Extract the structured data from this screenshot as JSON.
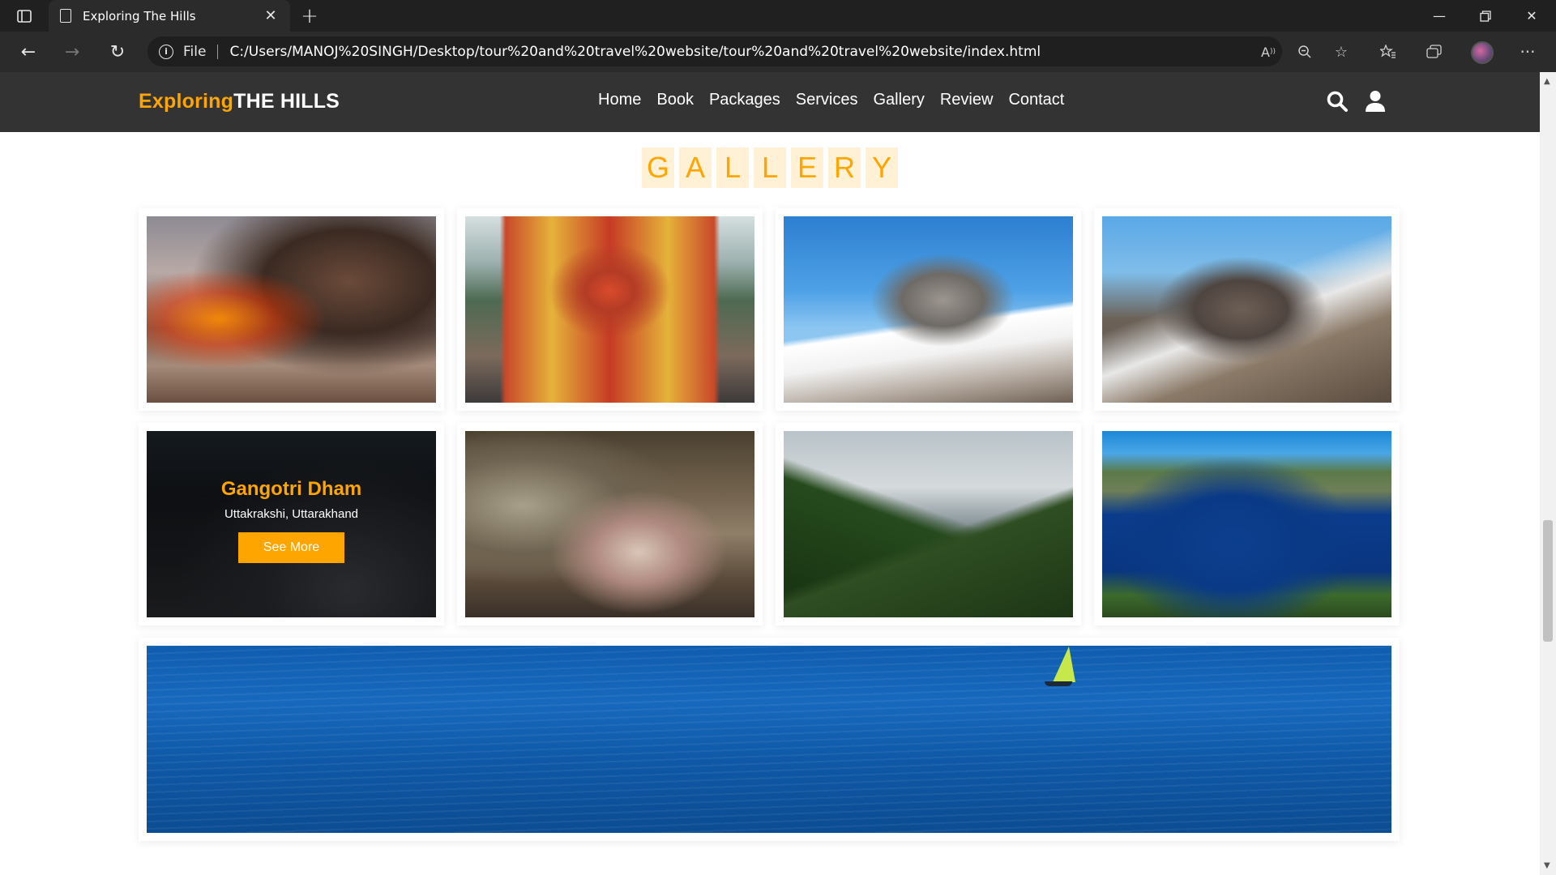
{
  "browser": {
    "tab_title": "Exploring The Hills",
    "address_scheme": "File",
    "url": "C:/Users/MANOJ%20SINGH/Desktop/tour%20and%20travel%20website/tour%20and%20travel%20website/index.html"
  },
  "site": {
    "logo_accent": "Exploring",
    "logo_rest": "THE HILLS",
    "nav": [
      "Home",
      "Book",
      "Packages",
      "Services",
      "Gallery",
      "Review",
      "Contact"
    ],
    "accent_color": "#ffa500",
    "header_color": "#333333"
  },
  "gallery": {
    "heading_letters": [
      "G",
      "A",
      "L",
      "L",
      "E",
      "R",
      "Y"
    ],
    "featured": {
      "title": "Gangotri Dham",
      "location": "Uttakrakshi, Uttarakhand",
      "button": "See More"
    }
  }
}
